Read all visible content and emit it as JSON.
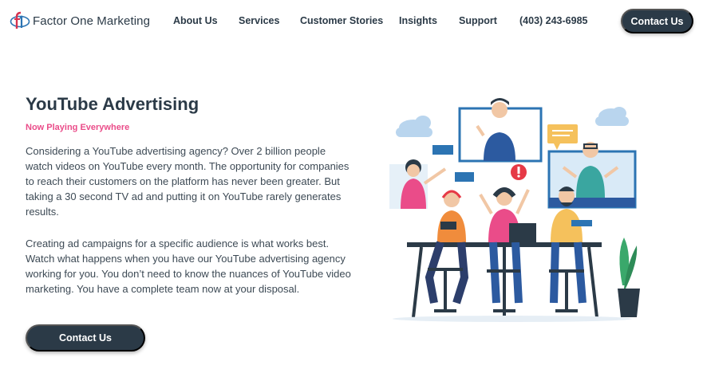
{
  "brand": {
    "name": "Factor One Marketing",
    "logo_icon": "factor-one-logo"
  },
  "nav": {
    "items": [
      {
        "label": "About Us"
      },
      {
        "label": "Services"
      },
      {
        "label": "Customer Stories"
      },
      {
        "label": "Insights"
      },
      {
        "label": "Support"
      }
    ],
    "phone": "(403) 243-6985",
    "cta": "Contact Us"
  },
  "hero": {
    "title": "YouTube Advertising",
    "subtitle": "Now Playing Everywhere",
    "paragraphs": [
      "Considering a YouTube advertising agency? Over 2 billion people watch videos on YouTube every month. The opportunity for companies to reach their customers on the platform has never been greater. But taking a 30 second TV ad and putting it on YouTube rarely generates results.",
      "Creating ad campaigns for a specific audience is what works best. Watch what happens when you have our YouTube advertising agency working for you. You don’t need to know the nuances of YouTube video marketing. You have a complete team now at your disposal."
    ],
    "cta": "Contact Us"
  },
  "colors": {
    "navy": "#2b3a47",
    "pink": "#ea4c89",
    "blue": "#2c74b3",
    "orange": "#f08c3c"
  }
}
